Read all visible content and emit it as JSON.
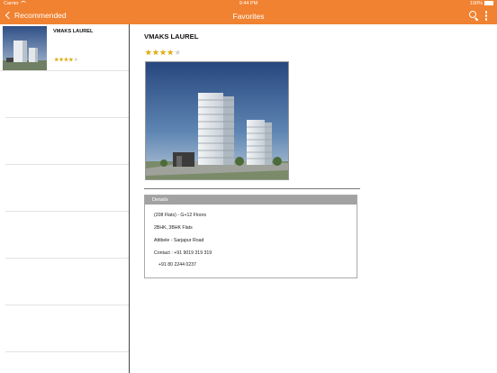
{
  "status_bar": {
    "carrier": "Carrier",
    "time": "9:44 PM",
    "battery": "100%"
  },
  "nav": {
    "back_label": "Recommended",
    "title": "Favorites",
    "right_icons": [
      "search-icon",
      "more-vertical-icon"
    ]
  },
  "list": {
    "items": [
      {
        "title": "VMAKS LAUREL",
        "rating": 4,
        "max_rating": 5
      }
    ],
    "empty_rows": 6
  },
  "detail": {
    "title": "VMAKS LAUREL",
    "rating": 4,
    "max_rating": 5,
    "details_header": "Details",
    "lines": [
      "(208 Flats) - G+12 Floors",
      "2BHK, 3BHK Flats",
      "Attibele - Sarjapur Road",
      "Contact : +91 9019 319 319",
      "+91 80 2244 0237"
    ]
  },
  "colors": {
    "nav_bar": "#f08231",
    "star_filled": "#e5b000",
    "star_empty": "#cfcfcf",
    "details_header": "#a2a2a2"
  }
}
